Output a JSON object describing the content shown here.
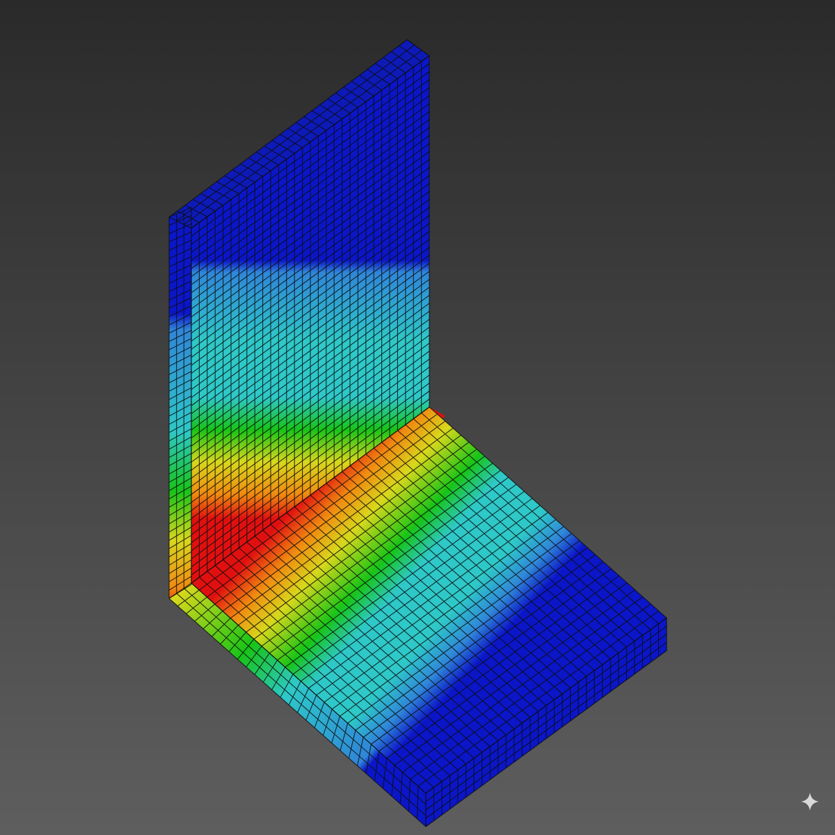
{
  "viewport": {
    "background_top": "#2a2a2a",
    "background_bottom": "#5e5e5e"
  },
  "model": {
    "type": "fe-mesh-contour",
    "shape": "L-bracket",
    "mesh_color": "#0d0d0d",
    "legend_visible": false
  },
  "contour_palette": [
    "#0b16c8",
    "#2f86d8",
    "#2ec8c8",
    "#17c417",
    "#d8d81c",
    "#f08a10",
    "#e01010"
  ],
  "watermark": {
    "icon": "sparkle-icon",
    "color": "#d9d9d9"
  }
}
